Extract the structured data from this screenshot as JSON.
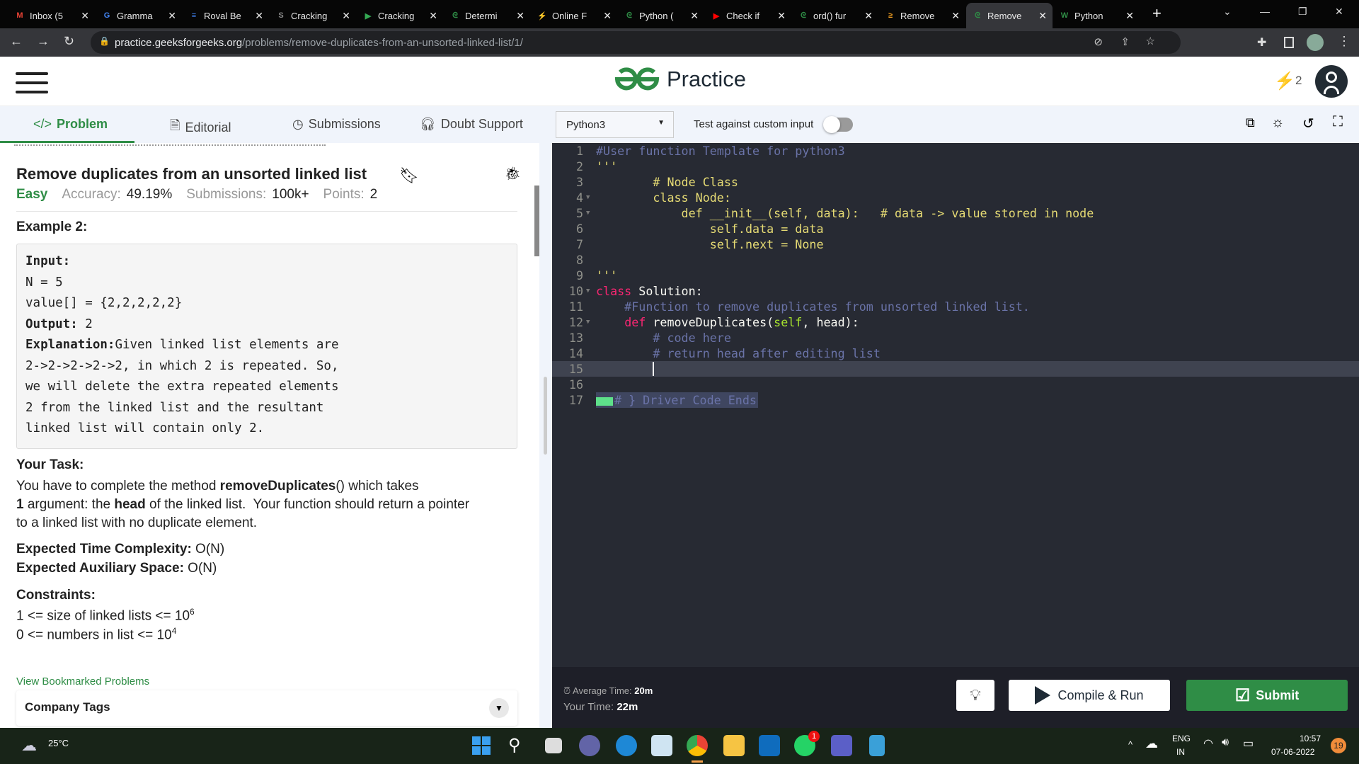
{
  "browser": {
    "tabs": [
      {
        "label": "Inbox (5",
        "icon": "gmail-icon",
        "color": "#ea4335",
        "glyph": "M"
      },
      {
        "label": "Gramma",
        "icon": "google-icon",
        "color": "#4285f4",
        "glyph": "G"
      },
      {
        "label": "Roval Be",
        "icon": "docs-icon",
        "color": "#4285f4",
        "glyph": "≡"
      },
      {
        "label": "Cracking",
        "icon": "site-icon",
        "color": "#888",
        "glyph": "S"
      },
      {
        "label": "Cracking",
        "icon": "play-icon",
        "color": "#34a853",
        "glyph": "▶"
      },
      {
        "label": "Determi",
        "icon": "gfg-icon",
        "color": "#2f8d46",
        "glyph": "ᘓ"
      },
      {
        "label": "Online F",
        "icon": "bolt-icon",
        "color": "#5b3f9a",
        "glyph": "⚡"
      },
      {
        "label": "Python (",
        "icon": "gfg-icon",
        "color": "#2f8d46",
        "glyph": "ᘓ"
      },
      {
        "label": "Check if",
        "icon": "youtube-icon",
        "color": "#ff0000",
        "glyph": "▶"
      },
      {
        "label": "ord() fur",
        "icon": "gfg-icon",
        "color": "#2f8d46",
        "glyph": "ᘓ"
      },
      {
        "label": "Remove",
        "icon": "site-icon",
        "color": "#f4a020",
        "glyph": "≥"
      },
      {
        "label": "Remove",
        "icon": "gfg-icon",
        "color": "#2f8d46",
        "glyph": "ᘓ",
        "active": true
      },
      {
        "label": "Python",
        "icon": "w-icon",
        "color": "#2f8d46",
        "glyph": "W"
      }
    ],
    "url_host": "practice.geeksforgeeks.org",
    "url_path": "/problems/remove-duplicates-from-an-unsorted-linked-list/1/"
  },
  "header": {
    "logo": "Practice",
    "streak": "2"
  },
  "toolbar": {
    "tabs": [
      "Problem",
      "Editorial",
      "Submissions",
      "Doubt Support"
    ],
    "language": "Python3",
    "custom_input_label": "Test against custom input",
    "custom_input_on": false
  },
  "problem": {
    "title": "Remove duplicates from an unsorted linked list",
    "difficulty": "Easy",
    "accuracy_label": "Accuracy:",
    "accuracy": "49.19%",
    "submissions_label": "Submissions:",
    "submissions": "100k+",
    "points_label": "Points:",
    "points": "2",
    "example_heading": "Example 2:",
    "example_lines": [
      "Input:",
      "N = 5",
      "value[] = {2,2,2,2,2}",
      "Output: 2",
      "Explanation:Given linked list elements are",
      "2->2->2->2->2, in which 2 is repeated. So,",
      "we will delete the extra repeated elements",
      "2 from the linked list and the resultant",
      "linked list will contain only 2."
    ],
    "task_heading": "Your Task:",
    "task_1": "You have to complete the method ",
    "task_method": "removeDuplicates",
    "task_2": "() which takes",
    "task_3": "1",
    "task_4": " argument: the ",
    "task_5": "head",
    "task_6": " of the linked list.  Your function should return a pointer",
    "task_7": "to a linked list with no duplicate element.",
    "time_label": "Expected Time Complexity:",
    "time": " O(N)",
    "space_label": "Expected Auxiliary Space:",
    "space": " O(N)",
    "constraints_heading": "Constraints:",
    "c1": "1 <= size of linked lists <= 10",
    "c1_exp": "6",
    "c2": "0 <= numbers in list <= 10",
    "c2_exp": "4",
    "bookmarks_link": "View Bookmarked Problems",
    "company_tags": "Company Tags"
  },
  "editor": {
    "lines": [
      {
        "n": "1",
        "t": "#User function Template for python3",
        "cls": "cm"
      },
      {
        "n": "2",
        "t": "'''",
        "cls": "st"
      },
      {
        "n": "3",
        "t": "        # Node Class",
        "cls": "st"
      },
      {
        "n": "4",
        "t": "        class Node:",
        "cls": "st",
        "fold": true
      },
      {
        "n": "5",
        "t": "            def __init__(self, data):   # data -> value stored in node",
        "cls": "st",
        "fold": true
      },
      {
        "n": "6",
        "t": "                self.data = data",
        "cls": "st"
      },
      {
        "n": "7",
        "t": "                self.next = None",
        "cls": "st"
      },
      {
        "n": "8",
        "t": "",
        "cls": "st"
      },
      {
        "n": "9",
        "t": "'''",
        "cls": "st"
      },
      {
        "n": "10",
        "t": "",
        "cls": "pl",
        "fold": true
      },
      {
        "n": "11",
        "t": "    #Function to remove duplicates from unsorted linked list.",
        "cls": "cm"
      },
      {
        "n": "12",
        "t": "",
        "cls": "pl",
        "fold": true
      },
      {
        "n": "13",
        "t": "        # code here",
        "cls": "cm"
      },
      {
        "n": "14",
        "t": "        # return head after editing list",
        "cls": "cm"
      },
      {
        "n": "15",
        "t": "",
        "cls": "pl",
        "active": true
      },
      {
        "n": "16",
        "t": "",
        "cls": "pl"
      },
      {
        "n": "17",
        "t": "# } Driver Code Ends",
        "cls": "cm"
      }
    ],
    "l10_kw": "class",
    "l10_rest": " Solution:",
    "l12_kw": "def",
    "l12_fn": " removeDuplicates(",
    "l12_self": "self",
    "l12_rest": ", head):"
  },
  "footer": {
    "avg_label": "Average Time:",
    "avg": "20m",
    "your_label": "Your Time:",
    "your": "22m",
    "compile": "Compile & Run",
    "submit": "Submit"
  },
  "taskbar": {
    "weather": "25°C",
    "lang1": "ENG",
    "lang2": "IN",
    "time": "10:57",
    "date": "07-06-2022",
    "notif": "19",
    "whatsapp_badge": "1"
  }
}
